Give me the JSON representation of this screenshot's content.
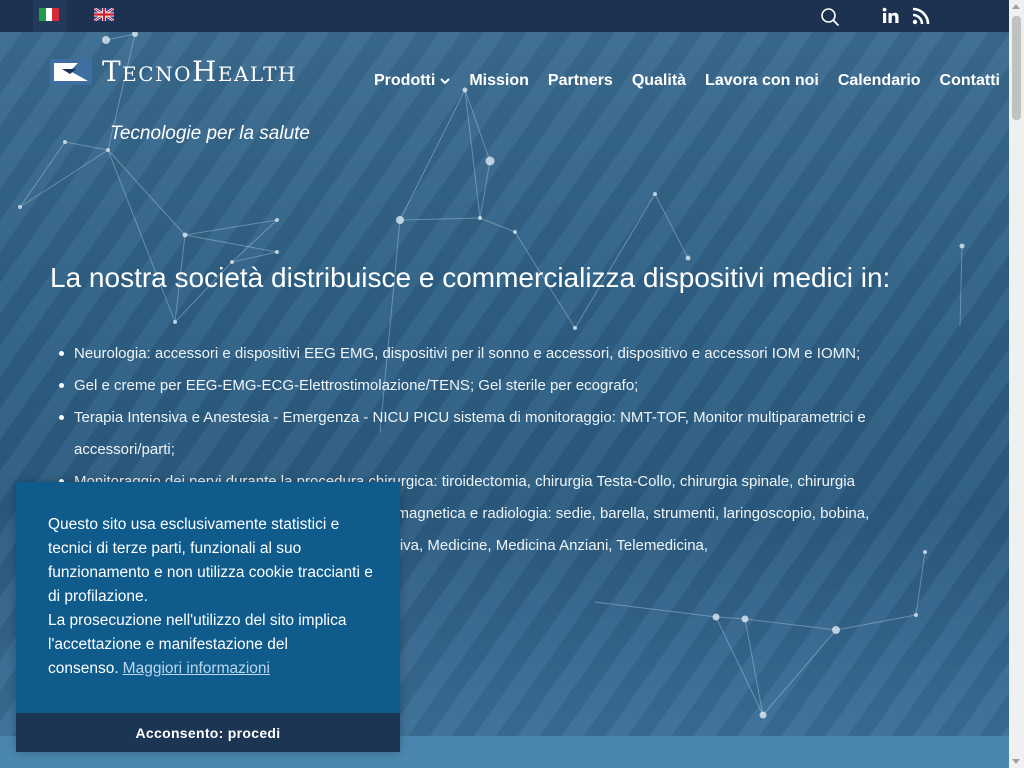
{
  "topbar": {
    "languages": [
      {
        "code": "it",
        "icon": "italian-flag-icon"
      },
      {
        "code": "en",
        "icon": "uk-flag-icon"
      }
    ],
    "icons": [
      "search-icon",
      "linkedin-icon",
      "rss-icon"
    ]
  },
  "header": {
    "logo_text": "TecnoHealth",
    "tagline": "Tecnologie per la salute"
  },
  "nav": {
    "items": [
      {
        "label": "Prodotti",
        "has_dropdown": true
      },
      {
        "label": "Mission"
      },
      {
        "label": "Partners"
      },
      {
        "label": "Qualità"
      },
      {
        "label": "Lavora con noi"
      },
      {
        "label": "Calendario"
      },
      {
        "label": "Contatti"
      }
    ]
  },
  "main": {
    "headline": "La nostra società distribuisce e commercializza dispositivi medici in:",
    "items": [
      "Neurologia: accessori e dispositivi EEG EMG, dispositivi per il sonno e accessori, dispositivo e accessori IOM e IOMN;",
      "Gel e creme per EEG-EMG-ECG-Elettrostimolazione/TENS; Gel sterile per ecografo;",
      "Terapia Intensiva e Anestesia - Emergenza - NICU PICU sistema di monitoraggio: NMT-TOF, Monitor multiparametrici e accessori/parti;",
      "Monitoraggio dei nervi durante la procedura chirurgica: tiroidectomia, chirurgia Testa-Collo, chirurgia spinale, chirurgia",
      "a magnetica e radiologia: sedie, barella, strumenti, laringoscopio, bobina,",
      "nsiva, Medicine, Medicina Anziani, Telemedicina,"
    ]
  },
  "cookie": {
    "text_1": "Questo sito usa esclusivamente statistici e tecnici di terze parti, funzionali al suo funzionamento e non utilizza cookie traccianti e di profilazione.",
    "text_2": "La prosecuzione nell'utilizzo del sito implica l'accettazione e manifestazione del consenso.",
    "link": "Maggiori informazioni",
    "button": "Acconsento: procedi"
  },
  "colors": {
    "topbar": "#1c3250",
    "hero": "#2f6186",
    "cookie_bg": "#0e5b8c",
    "cookie_button": "#1b3553"
  }
}
